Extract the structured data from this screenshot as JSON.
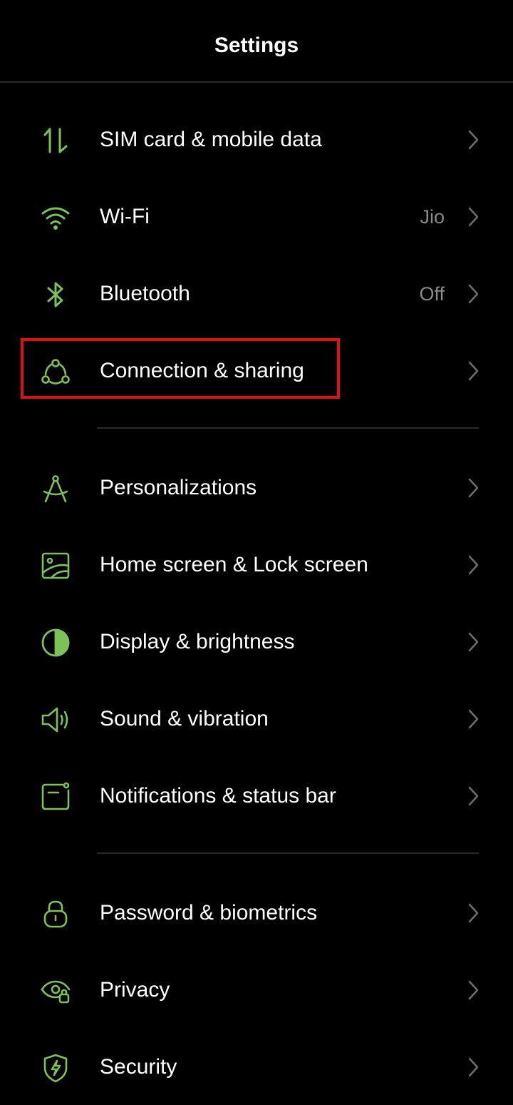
{
  "header": {
    "title": "Settings"
  },
  "colors": {
    "accent": "#7cc257",
    "highlight": "#e01010",
    "background": "#000000",
    "secondary_text": "#8a8a8a"
  },
  "groups": [
    {
      "items": [
        {
          "id": "sim",
          "icon": "mobile-data-arrows-icon",
          "label": "SIM card & mobile data",
          "value": ""
        },
        {
          "id": "wifi",
          "icon": "wifi-icon",
          "label": "Wi-Fi",
          "value": "Jio"
        },
        {
          "id": "bluetooth",
          "icon": "bluetooth-icon",
          "label": "Bluetooth",
          "value": "Off"
        },
        {
          "id": "connection",
          "icon": "connection-sharing-icon",
          "label": "Connection & sharing",
          "value": "",
          "highlighted": true
        }
      ]
    },
    {
      "items": [
        {
          "id": "personalizations",
          "icon": "compass-drawing-icon",
          "label": "Personalizations",
          "value": ""
        },
        {
          "id": "homescreen",
          "icon": "wallpaper-icon",
          "label": "Home screen & Lock screen",
          "value": ""
        },
        {
          "id": "display",
          "icon": "brightness-half-circle-icon",
          "label": "Display & brightness",
          "value": ""
        },
        {
          "id": "sound",
          "icon": "speaker-icon",
          "label": "Sound & vibration",
          "value": ""
        },
        {
          "id": "notifications",
          "icon": "notification-panel-icon",
          "label": "Notifications & status bar",
          "value": ""
        }
      ]
    },
    {
      "items": [
        {
          "id": "password",
          "icon": "lock-icon",
          "label": "Password & biometrics",
          "value": ""
        },
        {
          "id": "privacy",
          "icon": "privacy-eye-lock-icon",
          "label": "Privacy",
          "value": ""
        },
        {
          "id": "security",
          "icon": "shield-bolt-icon",
          "label": "Security",
          "value": ""
        }
      ]
    }
  ]
}
